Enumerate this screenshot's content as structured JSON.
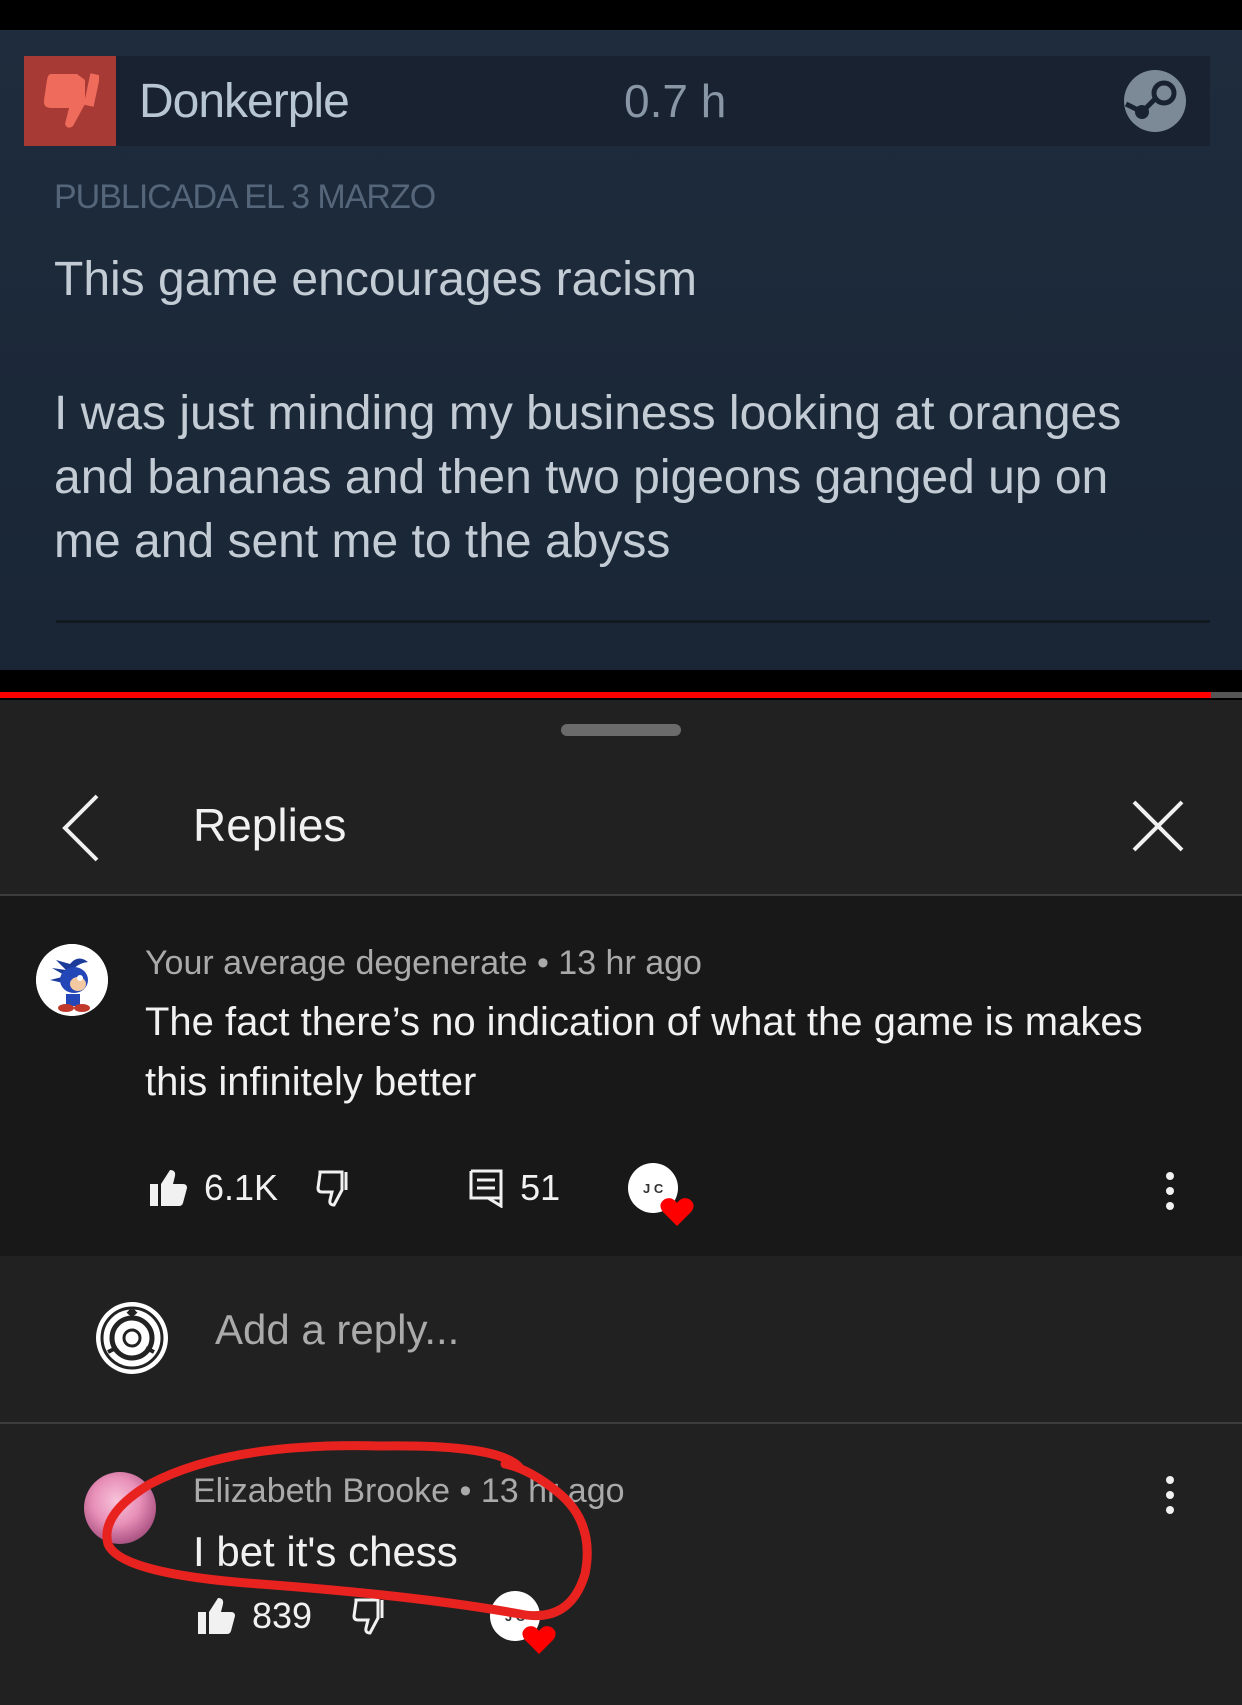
{
  "video": {
    "review": {
      "reviewer_name": "Donkerple",
      "hours": "0.7 h",
      "posted_date": "PUBLICADA EL 3 MARZO",
      "line1": "This game encourages racism",
      "body": "I was just minding my business looking at oranges and bananas and then two pigeons ganged up on me and sent me to the abyss",
      "rating_icon": "thumbs-down-icon",
      "platform_icon": "steam-icon"
    },
    "progress_fraction": 0.975,
    "progress_color": "#ff0000"
  },
  "sheet": {
    "title": "Replies",
    "back_icon": "chevron-left-icon",
    "close_icon": "close-icon"
  },
  "parent_comment": {
    "author": "Your average degenerate",
    "time": "13 hr ago",
    "meta": "Your average degenerate • 13 hr ago",
    "text": "The fact there’s no indication of what the game is makes this infinitely better",
    "likes": "6.1K",
    "replies": "51",
    "creator_initials": "J C"
  },
  "reply_box": {
    "placeholder": "Add a reply..."
  },
  "reply": {
    "author": "Elizabeth Brooke",
    "time": "13 hr ago",
    "meta": "Elizabeth Brooke • 13 hr ago",
    "text": "I bet it's chess",
    "likes": "839",
    "creator_initials": "J C",
    "highlight_color": "#e8231f"
  }
}
